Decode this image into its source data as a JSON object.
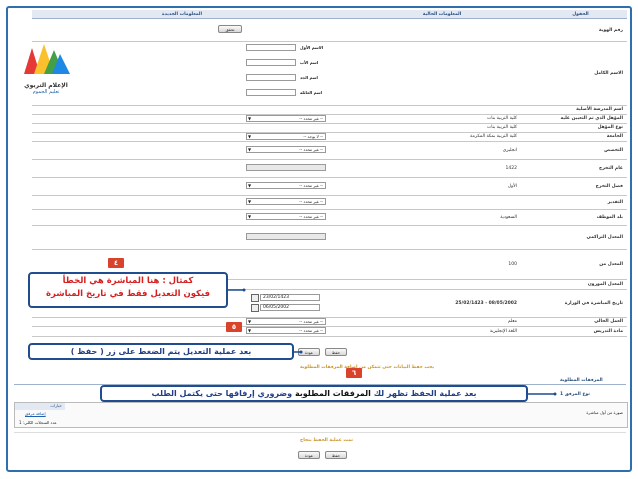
{
  "headers": {
    "label": "الحقول",
    "current": "المعلومات الحالية",
    "new": "المعلومات الجديدة"
  },
  "check_button": "تحقق",
  "fields": {
    "id_number": "رقم الهوية",
    "full_name": "الاسم الكامل",
    "name_parts": [
      "الاسم الأول",
      "اسم الأب",
      "اسم الجد",
      "اسم العائلة"
    ],
    "school": "اسم المدرسة الأصلية",
    "qualification_on_hire": "المؤهل الذي تم التعيين عليه",
    "qualification_type": "نوع المؤهل",
    "university": "الجامعة",
    "specialization": "التخصص",
    "grad_year": "عام التخرج",
    "grad_semester": "فصل التخرج",
    "grade": "التقدير",
    "employee_country": "بلد الموظف",
    "cumulative_gpa": "المعدل التراكمي",
    "gpa_from": "المعدل من",
    "weighted_gpa": "المعدل الموزون",
    "start_date_ministry": "تاريخ المباشرة في الوزارة",
    "current_position": "العمل الحالي",
    "teaching_subject": "مادة التدريس"
  },
  "values": {
    "qualification_on_hire": "كلية التربية بنات",
    "qualification_type": "كلية التربية بنات",
    "university": "كلية التربية بمكة المكرمة",
    "specialization": "انجليزي",
    "grad_year": "1422",
    "grad_semester": "الأول",
    "employee_country": "السعودية",
    "gpa_from": "100",
    "start_date_current": "08/05/2002 - 25/02/1423",
    "current_position": "معلم",
    "teaching_subject": "اللغة الإنجليزية",
    "new_date_hijri": "23/02/1423",
    "new_date_greg": "06/05/2002"
  },
  "select_placeholder": "-- غير محدد --",
  "select_placeholder_alt": "-- لا يوجد --",
  "save_button": "حفظ",
  "back_button": "عودة",
  "attachments": {
    "notice": "يجب حفظ البيانات حتى تتمكن من إضافة المرفقات المطلوبة",
    "section": "المرفقات المطلوبة",
    "attachment_type_label": "نوع المرفق 1",
    "col_options": "خيارات",
    "row_label": "صورة من أول مباشرة",
    "add_attachment": "إضافة مرفق",
    "count_label": "عدد السجلات الكلي: 1"
  },
  "success_message": "تمت عملية الحفظ بنجاح",
  "logo": {
    "line1": "الإعلام التربوي",
    "line2": "تعليم الجموم"
  },
  "callouts": {
    "c4_line1": "كمثال : هنا المباشرة هي الخطأ",
    "c4_line2": "فيكون التعديل فقط في تاريخ المباشرة",
    "c5_text": "بعد عملية التعديل يتم الضغط على زر",
    "c5_keyword": "( حفظ )",
    "c6_before": "بعد عملية الحفظ تظهر لك",
    "c6_highlight": "المرفقات المطلوبة",
    "c6_after": "وضروري إرفاقها حتى يكتمل الطلب"
  },
  "badges": {
    "b4": "٤",
    "b5": "٥",
    "b6": "٦"
  },
  "colors": {
    "frame": "#2f6fb0",
    "badge": "#d9432c",
    "callout_border": "#1f4d8f",
    "callout_red": "#d62020",
    "callout_blue": "#1f3e86"
  }
}
